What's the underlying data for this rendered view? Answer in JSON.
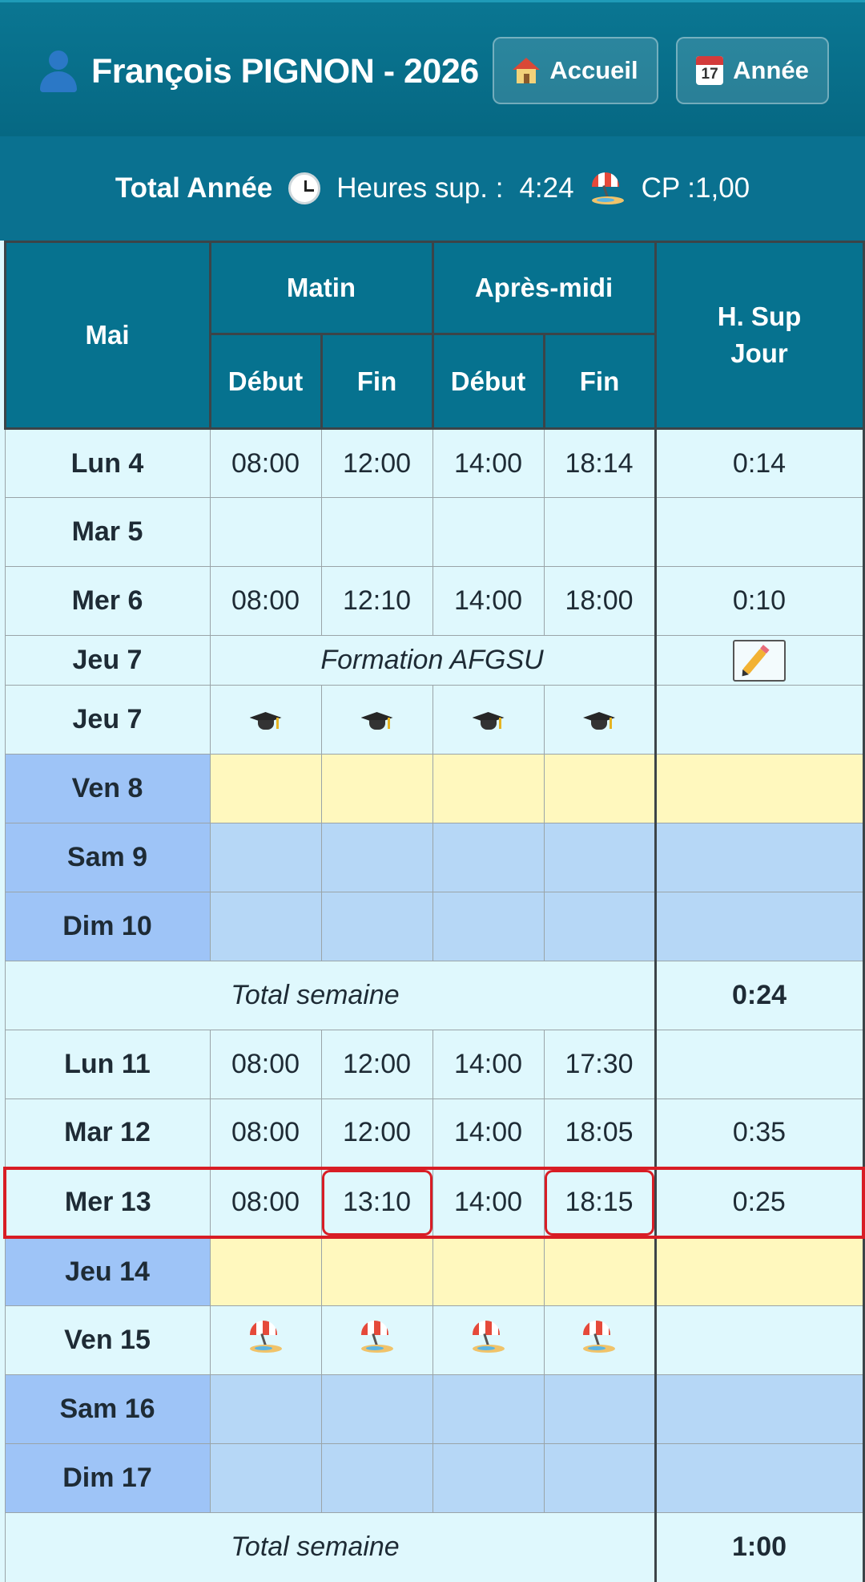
{
  "header": {
    "user_name": "François PIGNON - 2026",
    "home_label": "Accueil",
    "year_label": "Année",
    "calendar_icon_day": "17"
  },
  "summary": {
    "total_label": "Total Année",
    "overtime_label": "Heures sup. :",
    "overtime_value": "4:24",
    "cp_label": "CP :",
    "cp_value": "1,00"
  },
  "table": {
    "month": "Mai",
    "morning": "Matin",
    "afternoon": "Après-midi",
    "start": "Début",
    "end": "Fin",
    "hsup_header": "H. Sup Jour",
    "rows": [
      {
        "day": "Lun 4",
        "m_start": "08:00",
        "m_end": "12:00",
        "a_start": "14:00",
        "a_end": "18:14",
        "hsup": "0:14"
      },
      {
        "day": "Mar 5",
        "m_start": "",
        "m_end": "",
        "a_start": "",
        "a_end": "",
        "hsup": ""
      },
      {
        "day": "Mer 6",
        "m_start": "08:00",
        "m_end": "12:10",
        "a_start": "14:00",
        "a_end": "18:00",
        "hsup": "0:10"
      },
      {
        "day": "Jeu 7",
        "note": "Formation AFGSU"
      },
      {
        "day": "Jeu 7"
      },
      {
        "day": "Ven 8"
      },
      {
        "day": "Sam 9"
      },
      {
        "day": "Dim 10"
      },
      {
        "day": "Lun 11",
        "m_start": "08:00",
        "m_end": "12:00",
        "a_start": "14:00",
        "a_end": "17:30",
        "hsup": ""
      },
      {
        "day": "Mar 12",
        "m_start": "08:00",
        "m_end": "12:00",
        "a_start": "14:00",
        "a_end": "18:05",
        "hsup": "0:35"
      },
      {
        "day": "Mer 13",
        "m_start": "08:00",
        "m_end": "13:10",
        "a_start": "14:00",
        "a_end": "18:15",
        "hsup": "0:25"
      },
      {
        "day": "Jeu 14"
      },
      {
        "day": "Ven 15"
      },
      {
        "day": "Sam 16"
      },
      {
        "day": "Dim 17"
      }
    ],
    "week_total_label": "Total semaine",
    "week1_total": "0:24",
    "week2_total": "1:00"
  },
  "icons": {
    "user": "user-icon",
    "home": "house-icon",
    "calendar": "calendar-icon",
    "clock": "clock-icon",
    "beach": "beach-umbrella-icon",
    "training": "graduation-cap-icon",
    "edit": "pencil-icon"
  },
  "colors": {
    "header_bg": "#0a7692",
    "day_col": "#9ec4f7",
    "cell_bg": "#dff8fd",
    "weekend": "#b6d7f6",
    "holiday": "#fff8be",
    "late": "#ffd0d4",
    "current_row": "#d81d25"
  }
}
